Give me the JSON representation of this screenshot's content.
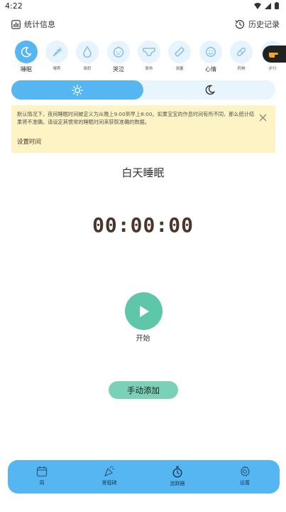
{
  "status_bar": {
    "time": "4:22"
  },
  "header": {
    "stats_label": "统计信息",
    "history_label": "历史记录"
  },
  "categories": [
    {
      "label": "睡眠",
      "icon": "moon-icon",
      "active": true
    },
    {
      "label": "喂养",
      "icon": "carrot-icon"
    },
    {
      "label": "吸奶",
      "icon": "drop-icon"
    },
    {
      "label": "哭泣",
      "icon": "baby-face-icon"
    },
    {
      "label": "尿布",
      "icon": "diaper-icon"
    },
    {
      "label": "测量",
      "icon": "ruler-icon"
    },
    {
      "label": "心情",
      "icon": "smile-icon"
    },
    {
      "label": "药物",
      "icon": "pill-icon"
    },
    {
      "label": "步行",
      "icon": "walk-icon"
    }
  ],
  "toggle": {
    "day_icon": "sun-icon",
    "night_icon": "moon-icon",
    "selected": "day"
  },
  "notice": {
    "text": "默认情况下，夜间睡眠时间被定义为从晚上9:00到早上8:00。如果宝宝的作息时间有所不同，那么统计结果将不准确。请设定其惯常的睡眠时间来获取准确的数据。",
    "link": "设置时间"
  },
  "main": {
    "mode_title": "白天睡眠",
    "timer": "00:00:00",
    "start_label": "开始",
    "manual_add_label": "手动添加"
  },
  "bottom_nav": [
    {
      "label": "周",
      "icon": "calendar-icon"
    },
    {
      "label": "里程碑",
      "icon": "party-popper-icon"
    },
    {
      "label": "追踪器",
      "icon": "stopwatch-icon"
    },
    {
      "label": "设置",
      "icon": "gear-icon"
    }
  ],
  "colors": {
    "accent": "#55b6f2",
    "accent_light": "#e8f4fd",
    "start_green": "#5ec7a9",
    "notice_bg": "#fdf3c5",
    "timer_brown": "#4a3528"
  }
}
